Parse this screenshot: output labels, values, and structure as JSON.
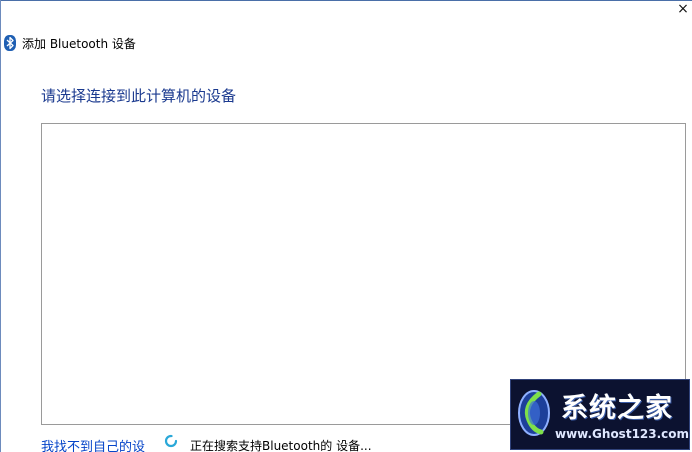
{
  "window": {
    "title": "添加 Bluetooth 设备",
    "close_glyph": "×"
  },
  "main": {
    "heading": "请选择连接到此计算机的设备",
    "device_list": []
  },
  "footer": {
    "not_found_link": "我找不到自己的设",
    "status_text": "正在搜索支持Bluetooth的 设备..."
  },
  "watermark": {
    "name": "系统之家",
    "url": "www.Ghost123.com"
  },
  "icons": {
    "window_icon": "bluetooth-icon",
    "status_icon": "loading-spinner-icon",
    "close_icon": "close-icon"
  },
  "colors": {
    "heading": "#1b3a8f",
    "link": "#0645c9",
    "bluetooth": "#1f5fb3",
    "spinner": "#2aa8d8"
  }
}
